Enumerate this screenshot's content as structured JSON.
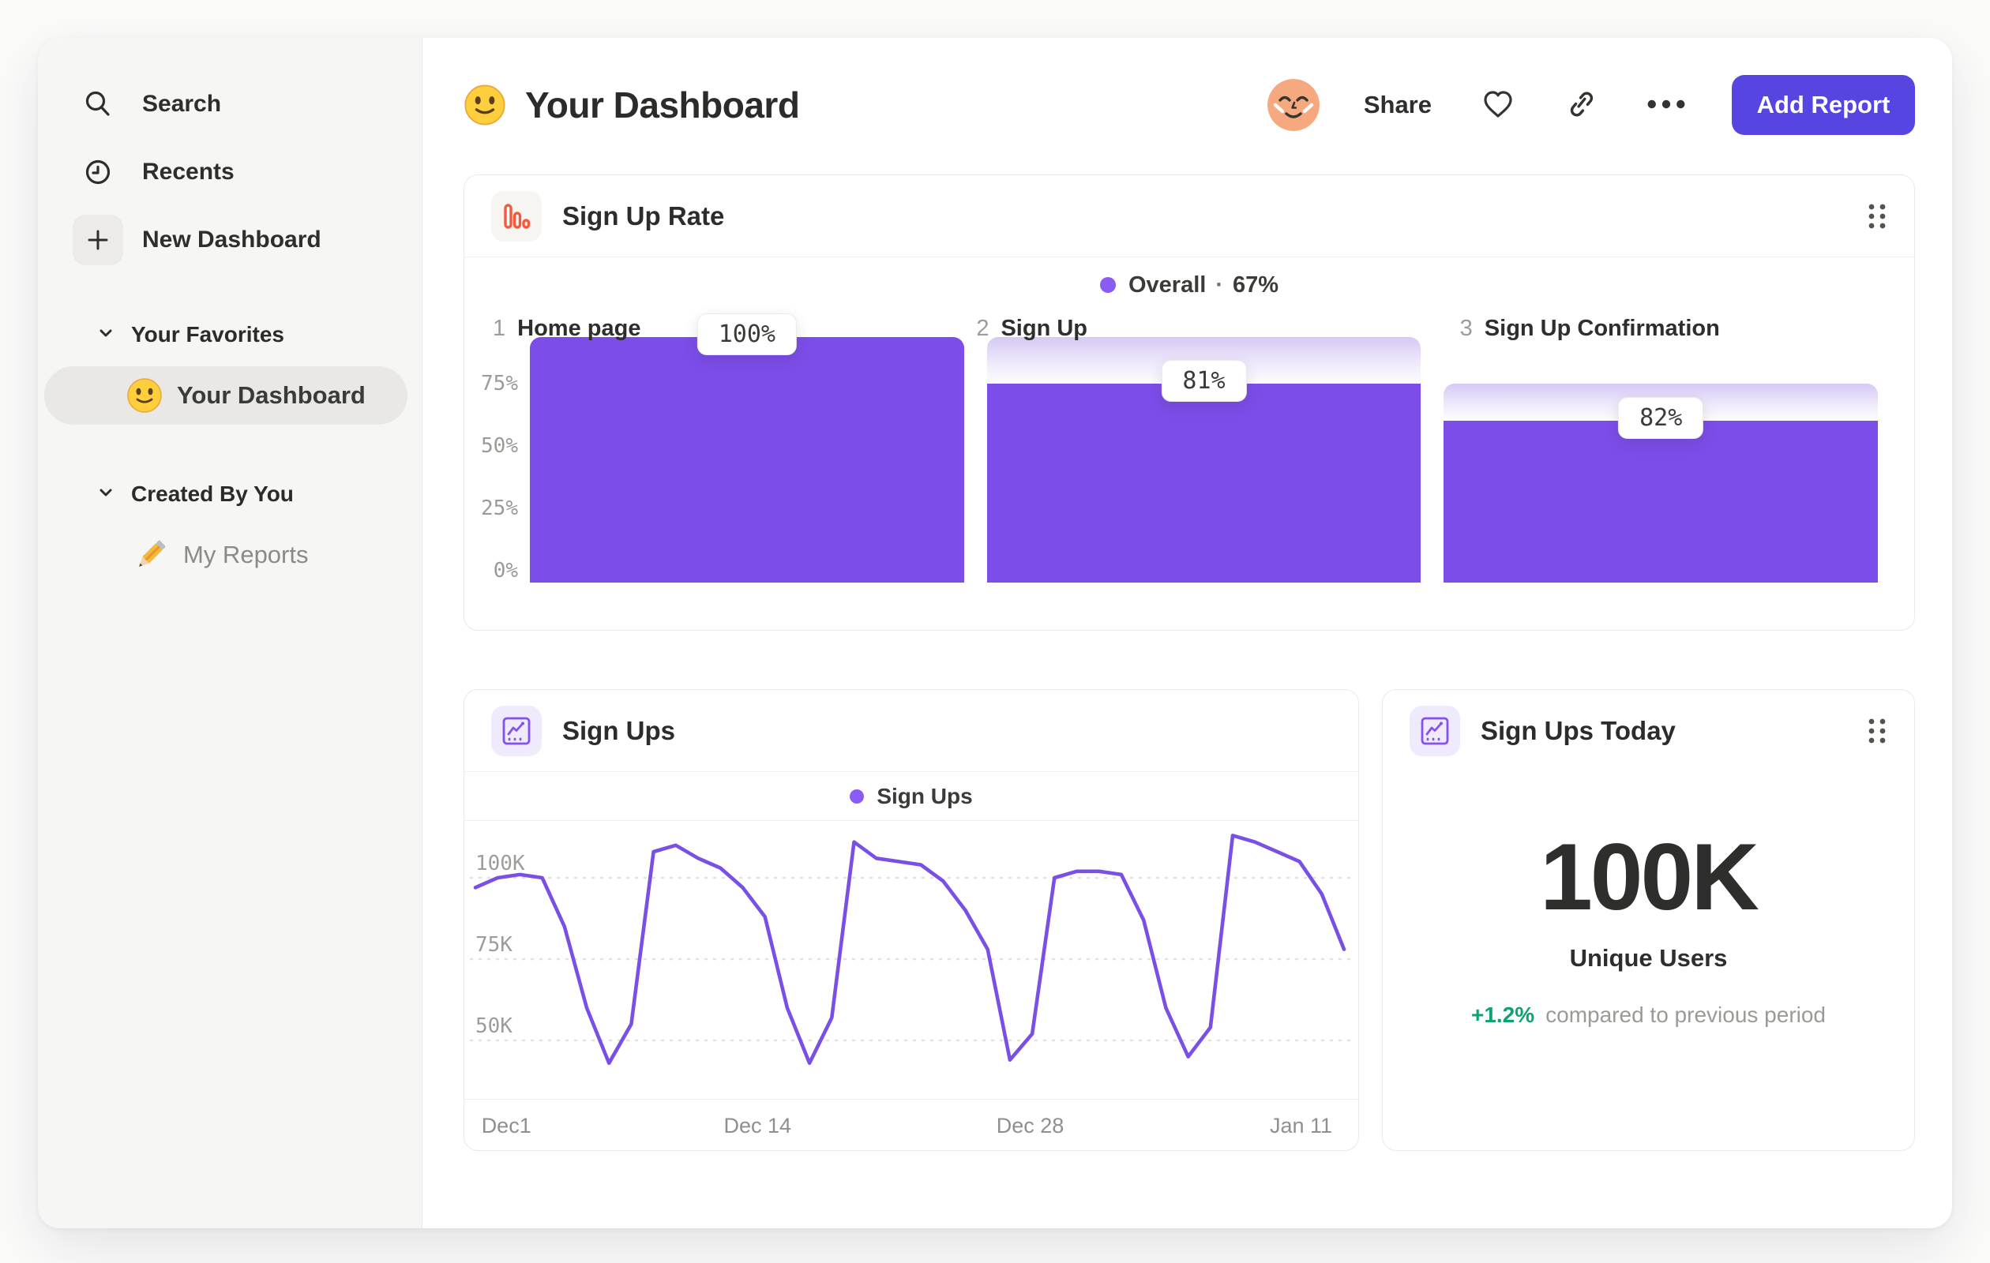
{
  "sidebar": {
    "nav": [
      {
        "icon": "search-icon",
        "label": "Search"
      },
      {
        "icon": "recents-clock-icon",
        "label": "Recents"
      },
      {
        "icon": "plus-icon",
        "label": "New Dashboard"
      }
    ],
    "sections": [
      {
        "title": "Your Favorites",
        "items": [
          {
            "icon": "smiley-emoji-icon",
            "label": "Your Dashboard",
            "selected": true
          }
        ]
      },
      {
        "title": "Created By You",
        "items": [
          {
            "icon": "pencil-emoji-icon",
            "label": "My Reports",
            "selected": false
          }
        ]
      }
    ]
  },
  "header": {
    "title_emoji": "smiley-emoji-icon",
    "title": "Your Dashboard",
    "share_label": "Share",
    "icons": [
      "avatar",
      "heart-icon",
      "link-icon",
      "ellipsis-icon"
    ],
    "add_report_label": "Add Report"
  },
  "cards": {
    "funnel": {
      "icon": "funnel-bars-icon",
      "title": "Sign Up Rate"
    },
    "line": {
      "icon": "line-chart-icon",
      "title": "Sign Ups"
    },
    "stat": {
      "icon": "line-chart-icon",
      "title": "Sign Ups Today",
      "value": "100K",
      "value_label": "Unique Users",
      "change": "+1.2%",
      "change_note": "compared to previous period",
      "change_color": "#0ba36e"
    }
  },
  "chart_data": [
    {
      "type": "bar",
      "variant": "funnel",
      "title": "Sign Up Rate",
      "legend": {
        "name": "Overall",
        "separator": "·",
        "value": "67%"
      },
      "y_ticks": [
        {
          "label": "75%",
          "pct": 75
        },
        {
          "label": "50%",
          "pct": 50
        },
        {
          "label": "25%",
          "pct": 25
        },
        {
          "label": "0%",
          "pct": 0
        }
      ],
      "steps": [
        {
          "index": "1",
          "name": "Home page",
          "label": "100%",
          "total_pct": 100,
          "value_pct": 100
        },
        {
          "index": "2",
          "name": "Sign Up",
          "label": "81%",
          "total_pct": 100,
          "value_pct": 81
        },
        {
          "index": "3",
          "name": "Sign Up Confirmation",
          "label": "82%",
          "total_pct": 81,
          "value_pct": 66
        }
      ],
      "colors": {
        "bar": "#7c4de8",
        "fade": "#d6c8f5",
        "legend_dot": "#8a5cf5"
      }
    },
    {
      "type": "line",
      "title": "Sign Ups",
      "legend": "Sign Ups",
      "unit": "K",
      "y_ticks": [
        {
          "label": "100K",
          "value": 100
        },
        {
          "label": "75K",
          "value": 75
        },
        {
          "label": "50K",
          "value": 50
        }
      ],
      "x_ticks": [
        {
          "label": "Dec1",
          "pos": 0.047
        },
        {
          "label": "Dec 14",
          "pos": 0.328
        },
        {
          "label": "Dec 28",
          "pos": 0.633
        },
        {
          "label": "Jan 11",
          "pos": 0.936
        }
      ],
      "values": [
        97,
        100,
        101,
        100,
        85,
        60,
        43,
        55,
        108,
        110,
        106,
        103,
        97,
        88,
        60,
        43,
        57,
        111,
        106,
        105,
        104,
        99,
        90,
        78,
        44,
        52,
        100,
        102,
        102,
        101,
        87,
        60,
        45,
        54,
        113,
        111,
        108,
        105,
        95,
        78
      ],
      "ylim": [
        40,
        115
      ],
      "grid": "dashed",
      "color": "#7a4fe6"
    }
  ]
}
